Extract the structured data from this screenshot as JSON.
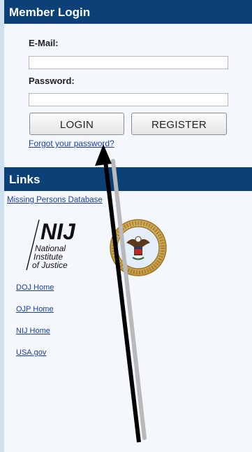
{
  "member_login": {
    "title": "Member Login",
    "email_label": "E-Mail:",
    "email_value": "",
    "password_label": "Password:",
    "password_value": "",
    "login_button": "LOGIN",
    "register_button": "REGISTER",
    "forgot_link": "Forgot your password?"
  },
  "links": {
    "title": "Links",
    "missing_persons": "Missing Persons Database",
    "nij_logo": {
      "letters": "NIJ",
      "line1": "National",
      "line2": "Institute",
      "line3": "of Justice"
    },
    "items": [
      "DOJ Home",
      "OJP Home",
      "NIJ Home",
      "USA.gov"
    ]
  },
  "colors": {
    "header_bg": "#0b4177",
    "link": "#1a3ea6",
    "page_bg": "#eef5fb"
  }
}
